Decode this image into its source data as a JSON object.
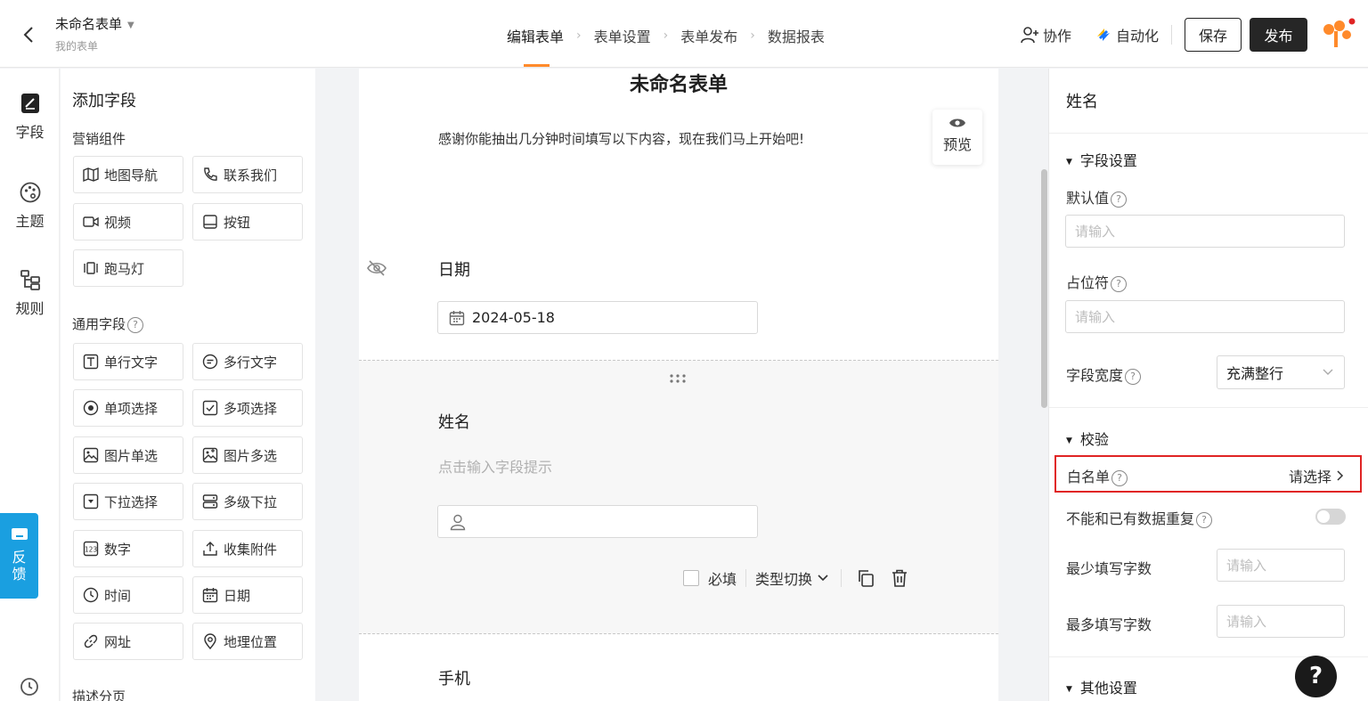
{
  "header": {
    "form_title": "未命名表单",
    "subtitle": "我的表单",
    "steps": [
      "编辑表单",
      "表单设置",
      "表单发布",
      "数据报表"
    ],
    "collab_label": "协作",
    "automation_label": "自动化",
    "save_label": "保存",
    "publish_label": "发布"
  },
  "leftnav": {
    "items": [
      "字段",
      "主题",
      "规则"
    ],
    "feedback_label": "反馈"
  },
  "fields_panel": {
    "title": "添加字段",
    "marketing_section": "营销组件",
    "marketing_items": [
      "地图导航",
      "联系我们",
      "视频",
      "按钮",
      "跑马灯"
    ],
    "common_section": "通用字段",
    "common_items": [
      "单行文字",
      "多行文字",
      "单项选择",
      "多项选择",
      "图片单选",
      "图片多选",
      "下拉选择",
      "多级下拉",
      "数字",
      "收集附件",
      "时间",
      "日期",
      "网址",
      "地理位置"
    ],
    "desc_section": "描述分页"
  },
  "canvas": {
    "form_title": "未命名表单",
    "description": "感谢你能抽出几分钟时间填写以下内容，现在我们马上开始吧!",
    "preview_label": "预览",
    "date_field_label": "日期",
    "date_value": "2024-05-18",
    "name_field_label": "姓名",
    "name_hint": "点击输入字段提示",
    "required_label": "必填",
    "type_switch_label": "类型切换",
    "phone_field_label": "手机"
  },
  "props": {
    "title": "姓名",
    "field_settings_title": "字段设置",
    "default_value_label": "默认值",
    "default_value_placeholder": "请输入",
    "placeholder_label": "占位符",
    "placeholder_placeholder": "请输入",
    "width_label": "字段宽度",
    "width_value": "充满整行",
    "validation_title": "校验",
    "whitelist_label": "白名单",
    "whitelist_value": "请选择",
    "no_duplicate_label": "不能和已有数据重复",
    "no_duplicate_enabled": false,
    "min_chars_label": "最少填写字数",
    "min_chars_placeholder": "请输入",
    "max_chars_label": "最多填写字数",
    "max_chars_placeholder": "请输入",
    "other_settings_title": "其他设置"
  },
  "help_label": "?",
  "colors": {
    "accent": "#ff8a2b",
    "feedback": "#1a9fe0",
    "highlight": "#e02424"
  }
}
